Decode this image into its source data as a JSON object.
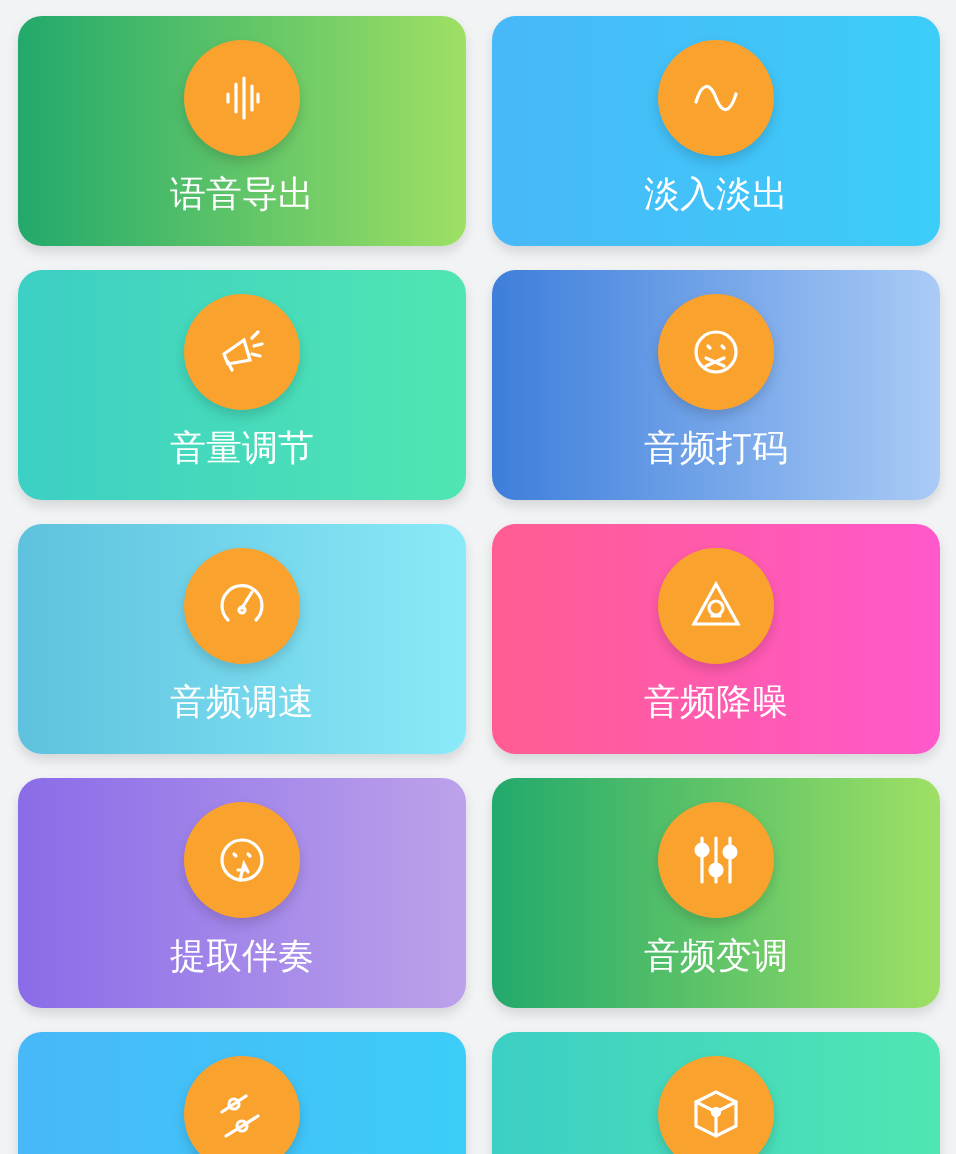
{
  "tools": [
    {
      "label": "语音导出"
    },
    {
      "label": "淡入淡出"
    },
    {
      "label": "音量调节"
    },
    {
      "label": "音频打码"
    },
    {
      "label": "音频调速"
    },
    {
      "label": "音频降噪"
    },
    {
      "label": "提取伴奏"
    },
    {
      "label": "音频变调"
    }
  ]
}
